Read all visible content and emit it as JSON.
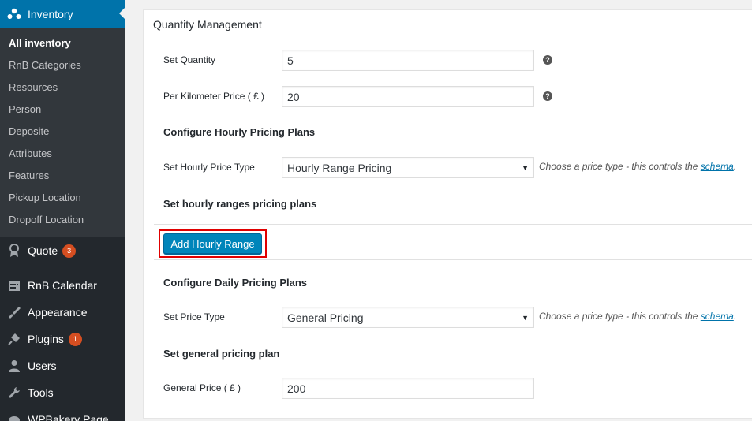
{
  "sidebar": {
    "inventory": {
      "label": "Inventory"
    },
    "submenu": [
      {
        "label": "All inventory",
        "current": true
      },
      {
        "label": "RnB Categories"
      },
      {
        "label": "Resources"
      },
      {
        "label": "Person"
      },
      {
        "label": "Deposite"
      },
      {
        "label": "Attributes"
      },
      {
        "label": "Features"
      },
      {
        "label": "Pickup Location"
      },
      {
        "label": "Dropoff Location"
      }
    ],
    "quote": {
      "label": "Quote",
      "badge": "3"
    },
    "calendar": {
      "label": "RnB Calendar"
    },
    "appearance": {
      "label": "Appearance"
    },
    "plugins": {
      "label": "Plugins",
      "badge": "1"
    },
    "users": {
      "label": "Users"
    },
    "tools": {
      "label": "Tools"
    },
    "wpbakery": {
      "label": "WPBakery Page"
    }
  },
  "panel": {
    "title": "Quantity Management",
    "set_quantity": {
      "label": "Set Quantity",
      "value": "5"
    },
    "per_km": {
      "label": "Per Kilometer Price ( £ )",
      "value": "20"
    },
    "hourly_heading": "Configure Hourly Pricing Plans",
    "hourly_type": {
      "label": "Set Hourly Price Type",
      "value": "Hourly Range Pricing",
      "desc": "Choose a price type - this controls the ",
      "link": "schema",
      "after": "."
    },
    "hourly_ranges_heading": "Set hourly ranges pricing plans",
    "add_hourly_range": "Add Hourly Range",
    "daily_heading": "Configure Daily Pricing Plans",
    "price_type": {
      "label": "Set Price Type",
      "value": "General Pricing",
      "desc": "Choose a price type - this controls the ",
      "link": "schema",
      "after": "."
    },
    "general_heading": "Set general pricing plan",
    "general_price": {
      "label": "General Price ( £ )",
      "value": "200"
    }
  },
  "colors": {
    "sidebar_bg": "#23282d",
    "submenu_bg": "#32373c",
    "accent": "#0073aa",
    "button": "#0085ba",
    "badge": "#d54e21",
    "highlight": "#e00000"
  },
  "icons": {
    "inventory": "users-group-icon",
    "quote": "award-icon",
    "calendar": "calendar-icon",
    "appearance": "paintbrush-icon",
    "plugins": "plug-icon",
    "users": "user-icon",
    "tools": "wrench-icon",
    "help": "help-icon"
  }
}
